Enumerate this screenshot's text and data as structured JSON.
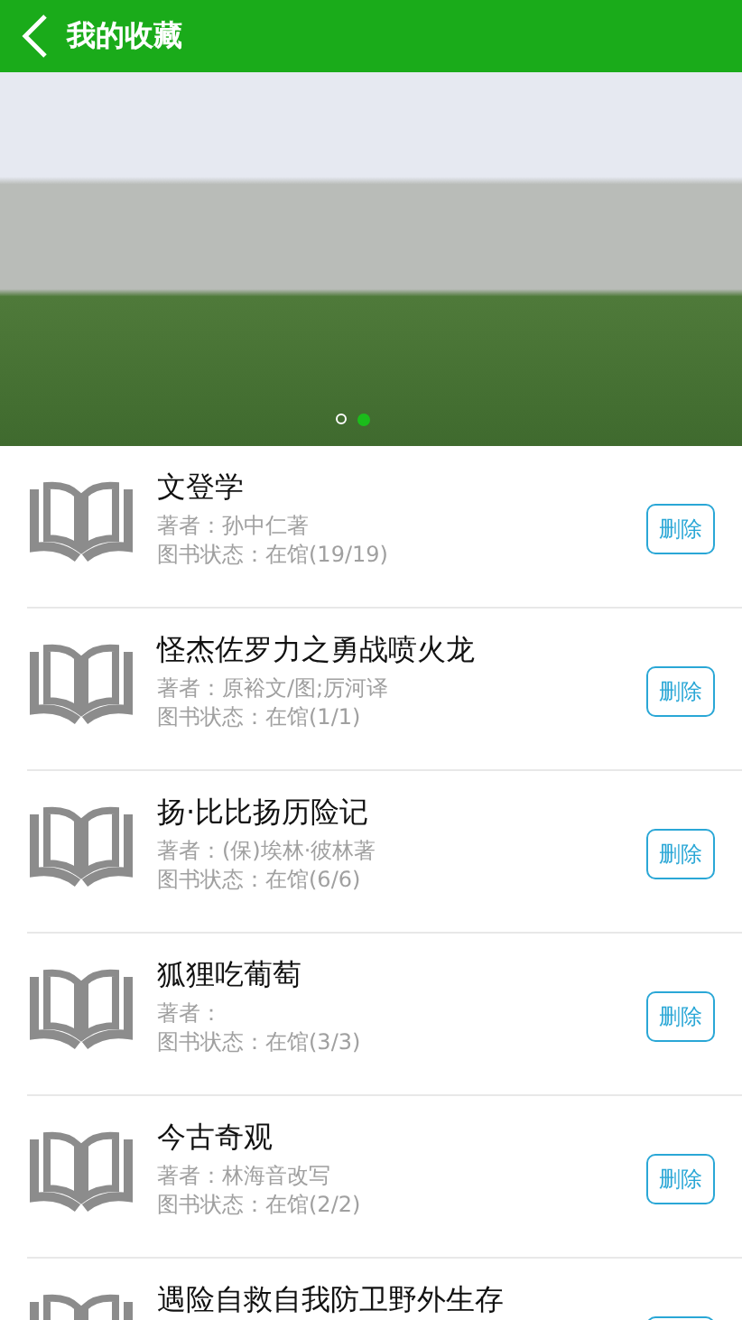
{
  "header": {
    "title": "我的收藏"
  },
  "banner": {
    "dots": [
      {
        "selected": false
      },
      {
        "selected": true
      }
    ]
  },
  "books": [
    {
      "title": "文登学",
      "author": "著者：孙中仁著",
      "status": "图书状态：在馆(19/19)",
      "delete": "删除"
    },
    {
      "title": "怪杰佐罗力之勇战喷火龙",
      "author": "著者：原裕文/图;厉河译",
      "status": "图书状态：在馆(1/1)",
      "delete": "删除"
    },
    {
      "title": "扬·比比扬历险记",
      "author": "著者：(保)埃林·彼林著",
      "status": "图书状态：在馆(6/6)",
      "delete": "删除"
    },
    {
      "title": "狐狸吃葡萄",
      "author": "著者：",
      "status": "图书状态：在馆(3/3)",
      "delete": "删除"
    },
    {
      "title": "今古奇观",
      "author": "著者：林海音改写",
      "status": "图书状态：在馆(2/2)",
      "delete": "删除"
    },
    {
      "title": "遇险自救自我防卫野外生存"
    }
  ]
}
